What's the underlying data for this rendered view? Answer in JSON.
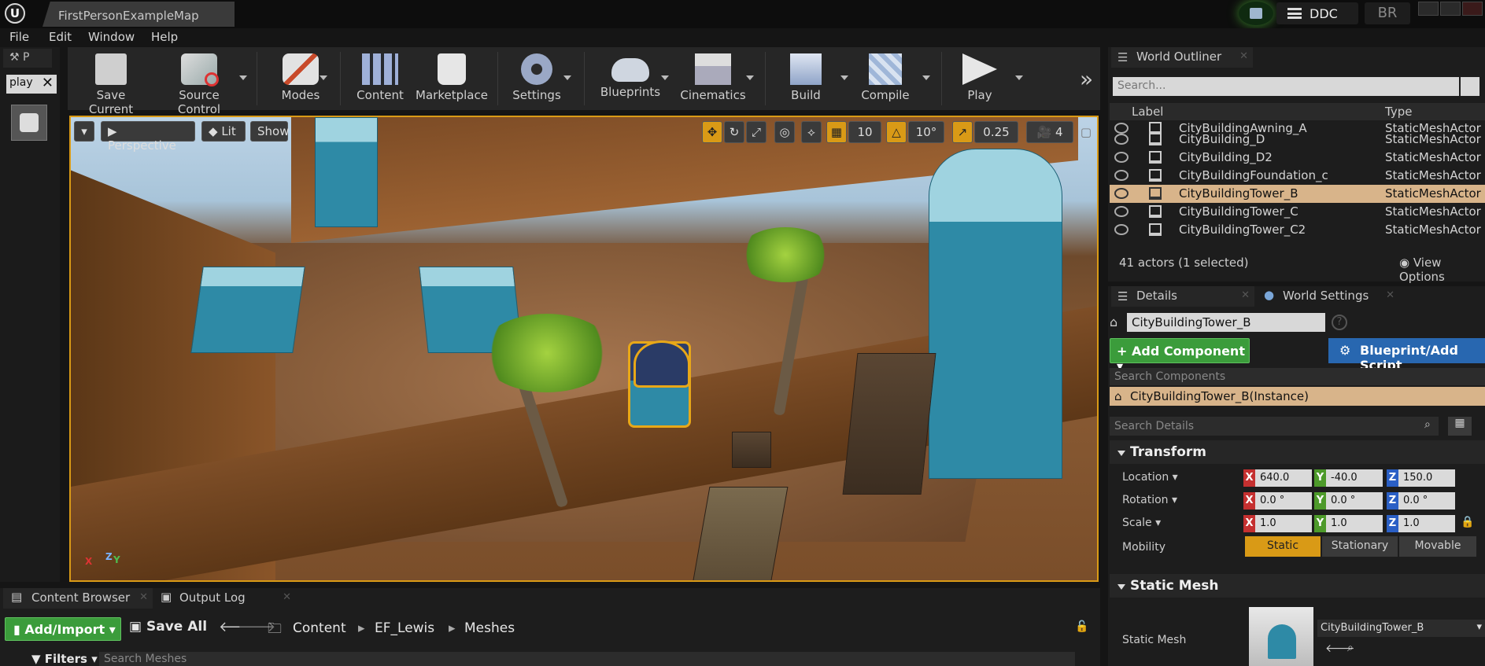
{
  "titlebar": {
    "tab": "FirstPersonExampleMap",
    "ddc": "DDC",
    "br": "BR"
  },
  "menu": [
    "File",
    "Edit",
    "Window",
    "Help"
  ],
  "left_panel": {
    "tab_label": "P",
    "search_value": "play"
  },
  "toolbar": {
    "buttons": [
      "Save Current",
      "Source Control",
      "Modes",
      "Content",
      "Marketplace",
      "Settings",
      "Blueprints",
      "Cinematics",
      "Build",
      "Compile",
      "Play"
    ],
    "more": "»"
  },
  "viewport": {
    "perspective": "Perspective",
    "lit": "Lit",
    "show": "Show",
    "grid_snap": "10",
    "rot_snap": "10°",
    "scale_snap": "0.25",
    "cam_speed": "4",
    "gizmo_x": "X",
    "gizmo_y": "Y",
    "gizmo_z": "Z"
  },
  "outliner": {
    "tab": "World Outliner",
    "search_placeholder": "Search...",
    "col_label": "Label",
    "col_type": "Type",
    "rows": [
      {
        "name": "CityBuildingAwning_A",
        "type": "StaticMeshActor"
      },
      {
        "name": "CityBuilding_D",
        "type": "StaticMeshActor"
      },
      {
        "name": "CityBuilding_D2",
        "type": "StaticMeshActor"
      },
      {
        "name": "CityBuildingFoundation_c",
        "type": "StaticMeshActor"
      },
      {
        "name": "CityBuildingTower_B",
        "type": "StaticMeshActor",
        "selected": true
      },
      {
        "name": "CityBuildingTower_C",
        "type": "StaticMeshActor"
      },
      {
        "name": "CityBuildingTower_C2",
        "type": "StaticMeshActor"
      }
    ],
    "status": "41 actors (1 selected)",
    "view_options": "View Options"
  },
  "details": {
    "tab_details": "Details",
    "tab_world_settings": "World Settings",
    "actor_name": "CityBuildingTower_B",
    "add_component": "+ Add Component",
    "blueprint_add": "Blueprint/Add Script",
    "search_components_placeholder": "Search Components",
    "instance": "CityBuildingTower_B(Instance)",
    "search_details_placeholder": "Search Details",
    "transform_label": "Transform",
    "location_label": "Location",
    "rotation_label": "Rotation",
    "scale_label": "Scale",
    "mobility_label": "Mobility",
    "location": {
      "x": "640.0",
      "y": "-40.0",
      "z": "150.0"
    },
    "rotation": {
      "x": "0.0 °",
      "y": "0.0 °",
      "z": "0.0 °"
    },
    "scale": {
      "x": "1.0",
      "y": "1.0",
      "z": "1.0"
    },
    "mobility": [
      "Static",
      "Stationary",
      "Movable"
    ],
    "static_mesh_section": "Static Mesh",
    "static_mesh_label": "Static Mesh",
    "static_mesh_value": "CityBuildingTower_B"
  },
  "content_browser": {
    "tab_content": "Content Browser",
    "tab_output": "Output Log",
    "add_import": "Add/Import",
    "save_all": "Save All",
    "breadcrumb": [
      "Content",
      "EF_Lewis",
      "Meshes"
    ],
    "filters": "Filters",
    "search_placeholder": "Search Meshes"
  },
  "colors": {
    "accent": "#d99a16",
    "selection": "#d8b48a",
    "add_green": "#3b9c3b",
    "blueprint_blue": "#2867b0"
  }
}
